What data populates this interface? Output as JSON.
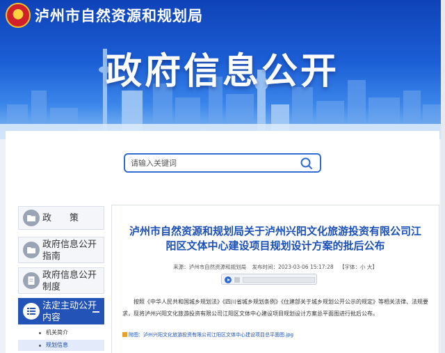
{
  "header": {
    "bureau_title": "泸州市自然资源和规划局",
    "main_title": "政府信息公开"
  },
  "search": {
    "placeholder": "请输入关键词"
  },
  "sidebar": {
    "items": [
      {
        "label": "政　　策",
        "icon": "folder-icon"
      },
      {
        "label": "政府信息公开指南",
        "icon": "folder-icon"
      },
      {
        "label": "政府信息公开制度",
        "icon": "document-icon"
      },
      {
        "label": "法定主动公开内容",
        "icon": "list-icon",
        "active": true
      }
    ],
    "sub_items": [
      "机关简介",
      "规划信息"
    ],
    "selected_sub": "规划信息"
  },
  "article": {
    "title": "泸州市自然资源和规划局关于泸州兴阳文化旅游投资有限公司江阳区文体中心建设项目规划设计方案的批后公布",
    "source": "来源：泸州市自然资源和规划局",
    "publish_time": "发布时间：2023-03-06 15:17:28",
    "font_size": "【字体：小 大】",
    "body": "按照《中华人民共和国城乡规划法》《四川省城乡规划条例》《住建部关于城乡规划公开公示的规定》等相关法律、法规要求，现将泸州兴阳文化旅游投资有限公司江阳区文体中心建设项目规划设计方案总平面图进行批后公布。",
    "attachment": "附图：泸州兴阳文化旅游投资有限公司江阳区文体中心建设项目总平面图.jpg"
  },
  "colors": {
    "banner": "#1c5fd6",
    "accent": "#2453b8",
    "title": "#1a4fb8"
  }
}
